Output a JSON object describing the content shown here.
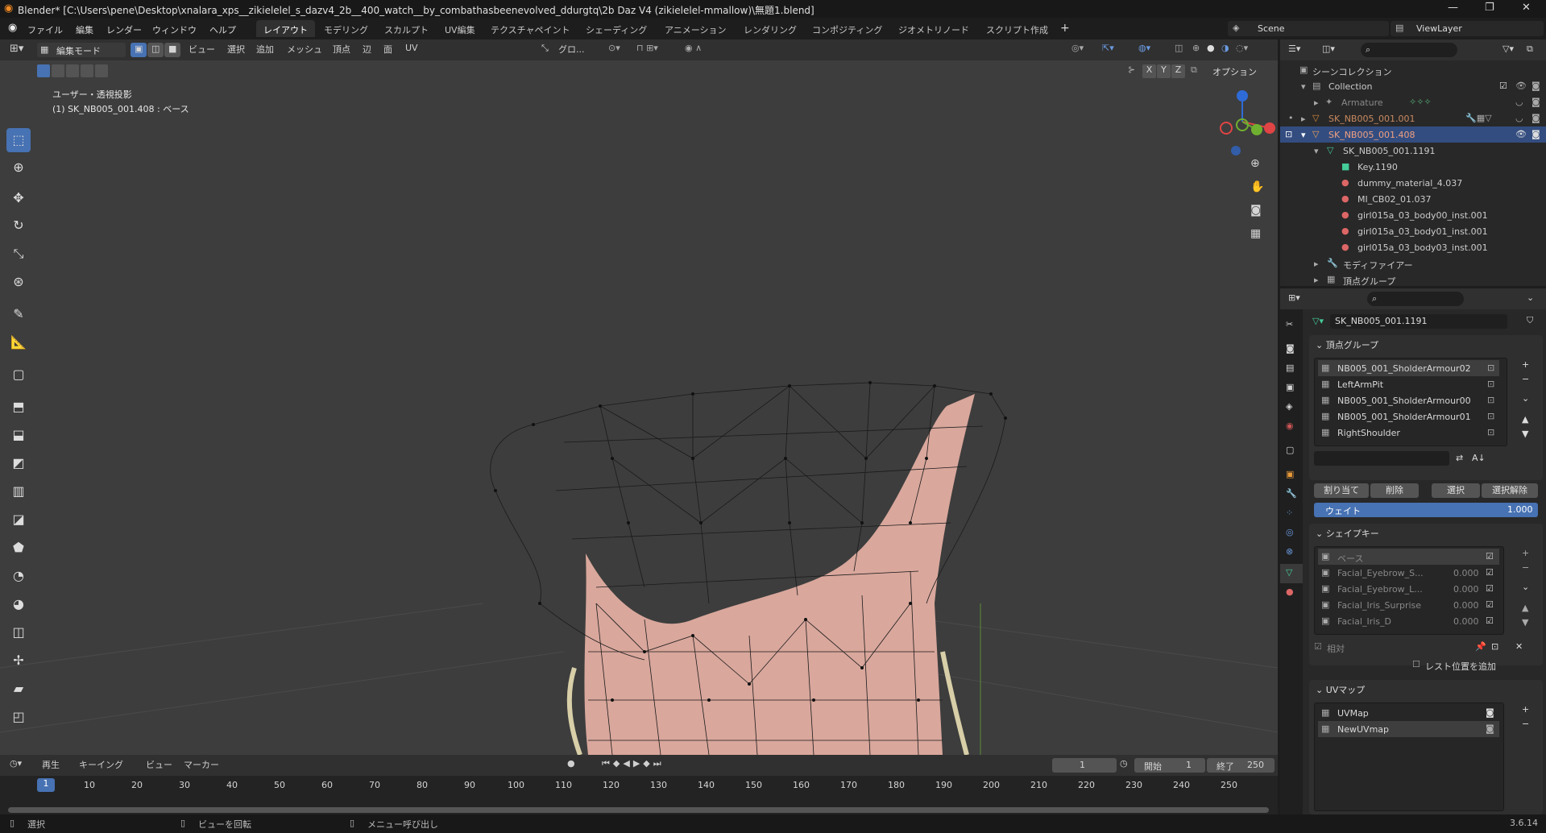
{
  "window": {
    "title": "Blender* [C:\\Users\\pene\\Desktop\\xnalara_xps__zikielelel_s_dazv4_2b__400_watch__by_combathasbeenevolved_ddurgtq\\2b Daz V4 (zikielelel-mmallow)\\無題1.blend]",
    "min": "—",
    "max": "❐",
    "close": "✕"
  },
  "menu": {
    "file": "ファイル",
    "edit": "編集",
    "render": "レンダー",
    "window": "ウィンドウ",
    "help": "ヘルプ"
  },
  "workspaces": [
    "レイアウト",
    "モデリング",
    "スカルプト",
    "UV編集",
    "テクスチャペイント",
    "シェーディング",
    "アニメーション",
    "レンダリング",
    "コンポジティング",
    "ジオメトリノード",
    "スクリプト作成"
  ],
  "scene": {
    "label": "Scene",
    "viewlayer": "ViewLayer"
  },
  "viewport": {
    "mode": "編集モード",
    "menus": [
      "ビュー",
      "選択",
      "追加",
      "メッシュ",
      "頂点",
      "辺",
      "面",
      "UV"
    ],
    "transform": "グロ...",
    "overlay_line1": "ユーザー・透視投影",
    "overlay_line2": "(1) SK_NB005_001.408 : ベース",
    "options": "オプション",
    "axes": [
      "X",
      "Y",
      "Z"
    ]
  },
  "timeline": {
    "menus": [
      "再生",
      "キーイング",
      "ビュー",
      "マーカー"
    ],
    "current_frame": "1",
    "start_label": "開始",
    "start": "1",
    "end_label": "終了",
    "end": "250",
    "ticks": [
      "1",
      "10",
      "20",
      "30",
      "40",
      "50",
      "60",
      "70",
      "80",
      "90",
      "100",
      "110",
      "120",
      "130",
      "140",
      "150",
      "160",
      "170",
      "180",
      "190",
      "200",
      "210",
      "220",
      "230",
      "240",
      "250"
    ]
  },
  "status": {
    "select": "選択",
    "rotate": "ビューを回転",
    "menu": "メニュー呼び出し",
    "version": "3.6.14"
  },
  "outliner": {
    "scene_collection": "シーンコレクション",
    "rows": [
      "Collection",
      "Armature",
      "SK_NB005_001.001",
      "SK_NB005_001.408",
      "SK_NB005_001.1191",
      "Key.1190",
      "dummy_material_4.037",
      "MI_CB02_01.037",
      "girl015a_03_body00_inst.001",
      "girl015a_03_body01_inst.001",
      "girl015a_03_body03_inst.001",
      "モディファイアー",
      "頂点グループ"
    ]
  },
  "properties": {
    "data_name": "SK_NB005_001.1191",
    "vertex_groups": {
      "title": "頂点グループ",
      "items": [
        "NB005_001_SholderArmour02",
        "LeftArmPit",
        "NB005_001_SholderArmour00",
        "NB005_001_SholderArmour01",
        "RightShoulder"
      ],
      "assign": "割り当て",
      "remove": "削除",
      "select": "選択",
      "deselect": "選択解除",
      "weight_label": "ウェイト",
      "weight": "1.000"
    },
    "shape_keys": {
      "title": "シェイプキー",
      "items": [
        {
          "name": "ベース",
          "value": ""
        },
        {
          "name": "Facial_Eyebrow_S...",
          "value": "0.000"
        },
        {
          "name": "Facial_Eyebrow_L...",
          "value": "0.000"
        },
        {
          "name": "Facial_Iris_Surprise",
          "value": "0.000"
        },
        {
          "name": "Facial_Iris_D",
          "value": "0.000"
        }
      ],
      "relative": "相対",
      "add_rest": "レスト位置を追加"
    },
    "uv_maps": {
      "title": "UVマップ",
      "items": [
        "UVMap",
        "NewUVmap"
      ]
    }
  },
  "colors": {
    "accent": "#4772b3",
    "selected_row": "#334d80",
    "mesh": "#d9a79c"
  }
}
